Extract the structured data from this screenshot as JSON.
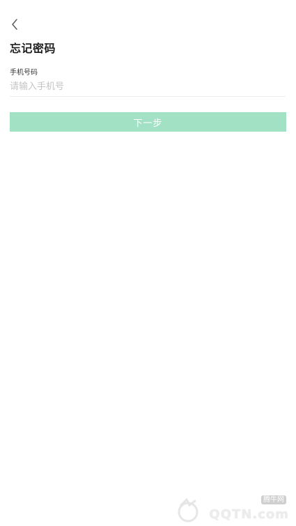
{
  "header": {
    "back_icon": "chevron-left-icon",
    "title": "忘记密码"
  },
  "form": {
    "phone_label": "手机号码",
    "phone_placeholder": "请输入手机号",
    "phone_value": ""
  },
  "actions": {
    "next_label": "下一步"
  },
  "watermark": {
    "name": "腾牛网",
    "domain": "QQTN.com"
  },
  "colors": {
    "accent": "#a3e1c5",
    "placeholder": "#c4c4c4",
    "title": "#1f1f1f",
    "background": "#ffffff"
  }
}
